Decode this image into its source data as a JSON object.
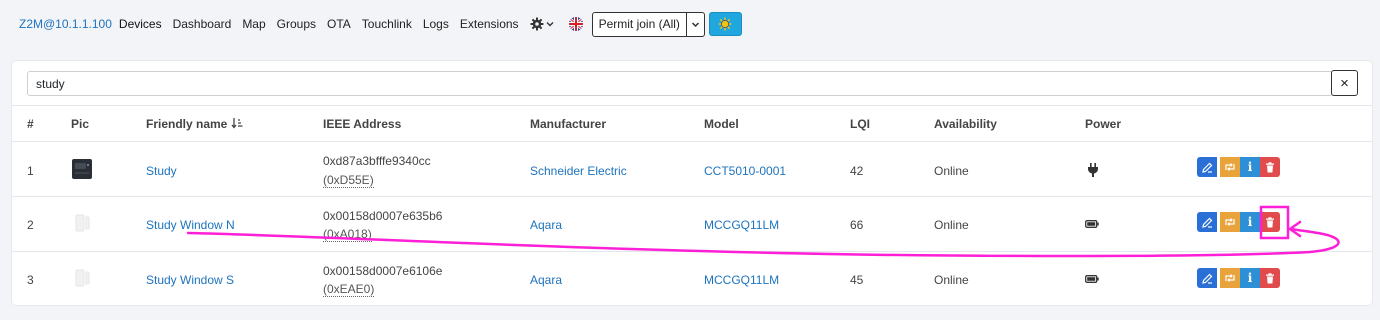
{
  "nav": {
    "brand": "Z2M@10.1.1.100",
    "links": [
      "Devices",
      "Dashboard",
      "Map",
      "Groups",
      "OTA",
      "Touchlink",
      "Logs",
      "Extensions"
    ],
    "permit_label": "Permit join (All)"
  },
  "search": {
    "value": "study",
    "clear_label": "×"
  },
  "table": {
    "headers": [
      "#",
      "Pic",
      "Friendly name",
      "IEEE Address",
      "Manufacturer",
      "Model",
      "LQI",
      "Availability",
      "Power"
    ],
    "rows": [
      {
        "num": "1",
        "name": "Study",
        "ieee": "0xd87a3bfffe9340cc",
        "nwk": "(0xD55E)",
        "manufacturer": "Schneider Electric",
        "model": "CCT5010-0001",
        "lqi": "42",
        "availability": "Online",
        "power": "plug-icon"
      },
      {
        "num": "2",
        "name": "Study Window N",
        "ieee": "0x00158d0007e635b6",
        "nwk": "(0xA018)",
        "manufacturer": "Aqara",
        "model": "MCCGQ11LM",
        "lqi": "66",
        "availability": "Online",
        "power": "battery-icon"
      },
      {
        "num": "3",
        "name": "Study Window S",
        "ieee": "0x00158d0007e6106e",
        "nwk": "(0xEAE0)",
        "manufacturer": "Aqara",
        "model": "MCCGQ11LM",
        "lqi": "45",
        "availability": "Online",
        "power": "battery-icon"
      }
    ]
  },
  "colors": {
    "link": "#1e73be",
    "edit": "#2a6fd6",
    "rename": "#e8a33b",
    "info": "#2d8fd6",
    "delete": "#e14b4b",
    "annotation": "#ff1fd6"
  }
}
